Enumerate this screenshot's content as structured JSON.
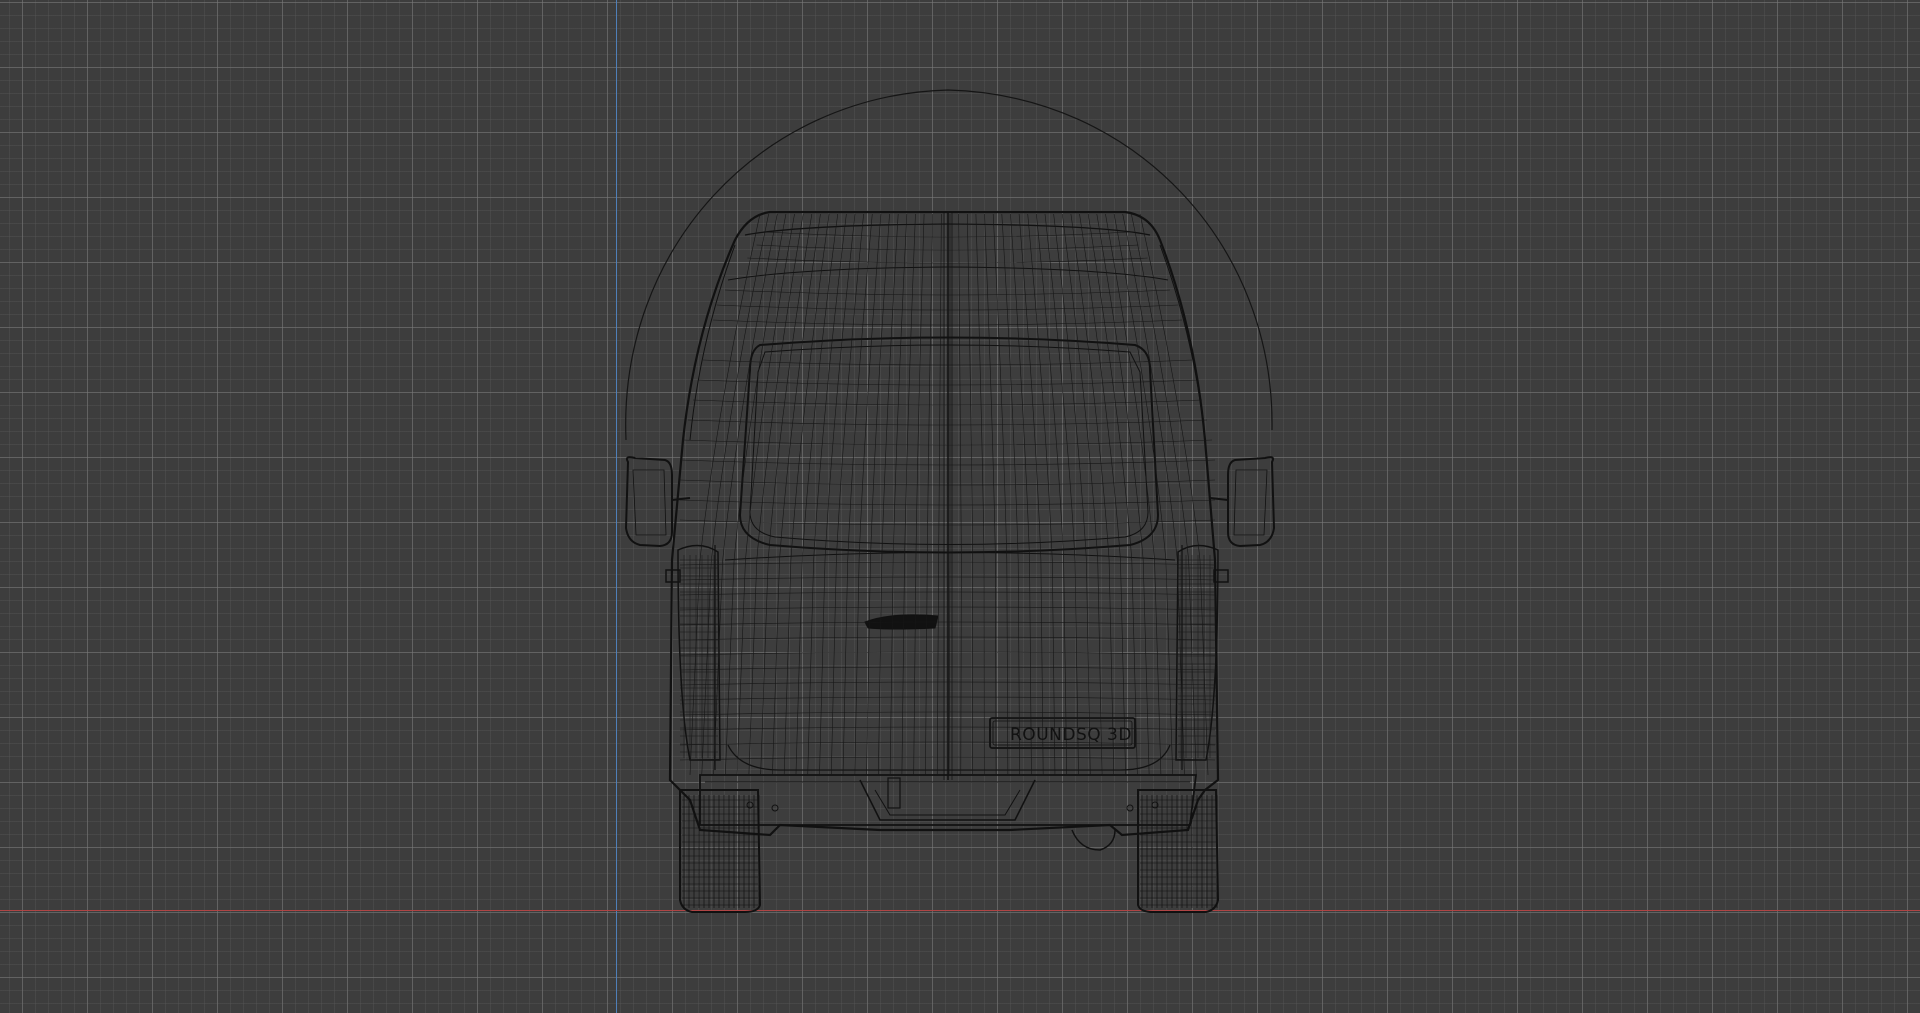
{
  "viewport": {
    "background": "#3d3d3d",
    "grid_color": "#5a5a5a",
    "x_axis_color": "#b04545",
    "y_axis_color": "#4f7fb8",
    "wire_color": "#111111"
  },
  "model": {
    "plate_text": "ROUNDSQ 3D"
  }
}
